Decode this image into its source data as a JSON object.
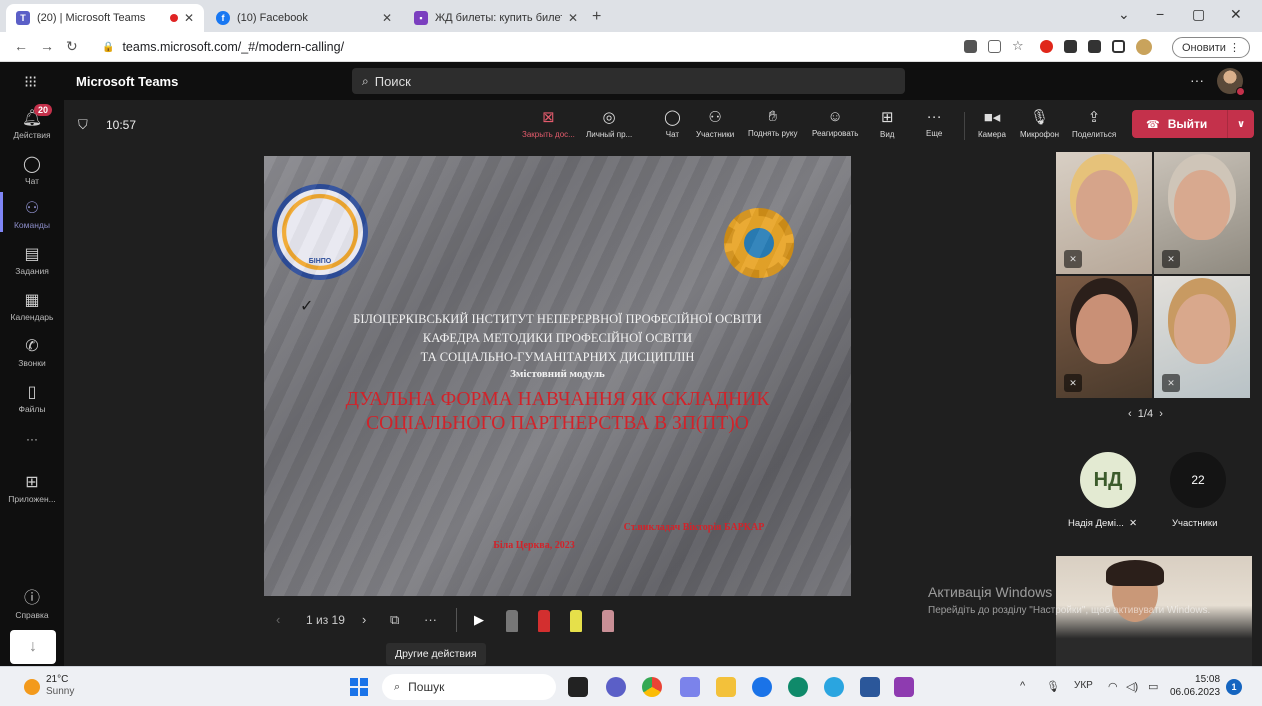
{
  "browser": {
    "tabs": [
      {
        "title": "(20) | Microsoft Teams",
        "active": true
      },
      {
        "title": "(10) Facebook",
        "active": false
      },
      {
        "title": "ЖД билеты: купить билет на по",
        "active": false
      }
    ],
    "url": "teams.microsoft.com/_#/modern-calling/",
    "update_label": "Оновити"
  },
  "teams": {
    "app_title": "Microsoft Teams",
    "search_placeholder": "Поиск",
    "rail": [
      {
        "label": "Действия",
        "icon": "bell-icon",
        "badge": "20"
      },
      {
        "label": "Чат",
        "icon": "chat-icon"
      },
      {
        "label": "Команды",
        "icon": "teams-icon",
        "active": true
      },
      {
        "label": "Задания",
        "icon": "assignments-icon"
      },
      {
        "label": "Календарь",
        "icon": "calendar-icon"
      },
      {
        "label": "Звонки",
        "icon": "phone-icon"
      },
      {
        "label": "Файлы",
        "icon": "file-icon"
      },
      {
        "label": "Приложен...",
        "icon": "apps-icon"
      },
      {
        "label": "Справка",
        "icon": "help-icon"
      }
    ]
  },
  "call": {
    "timer": "10:57",
    "controls": {
      "stop_sharing": "Закрыть дос...",
      "personal": "Личный пр...",
      "chat": "Чат",
      "participants": "Участники",
      "raise_hand": "Поднять руку",
      "react": "Реагировать",
      "view": "Вид",
      "more": "Еще",
      "camera": "Камера",
      "mic": "Микрофон",
      "share": "Поделиться"
    },
    "leave_label": "Выйти"
  },
  "slide": {
    "institute": "БІЛОЦЕРКІВСЬКИЙ ІНСТИТУТ НЕПЕРЕРВНОЇ ПРОФЕСІЙНОЇ ОСВІТИ",
    "department_1": "КАФЕДРА МЕТОДИКИ ПРОФЕСІЙНОЇ ОСВІТИ",
    "department_2": "ТА СОЦІАЛЬНО-ГУМАНІТАРНИХ ДИСЦИПЛІН",
    "module": "Змістовний модуль",
    "title_1": "ДУАЛЬНА ФОРМА НАВЧАННЯ ЯК СКЛАДНИК",
    "title_2": "СОЦІАЛЬНОГО ПАРТНЕРСТВА В ЗП(ПТ)О",
    "author": "Ст.викладач Вікторія БАРКАР",
    "city_year": "Біла Церква, 2023",
    "logo_left_text": "БІНПО",
    "page_indicator": "1 из 19",
    "tooltip": "Другие действия"
  },
  "participants": {
    "pager": "1/4",
    "avatar_initials": "НД",
    "avatar_name": "Надія Демі...",
    "count": "22",
    "count_label": "Участники"
  },
  "watermark": {
    "line1": "Активація Windows",
    "line2": "Перейдіть до розділу \"Настройки\", щоб активувати Windows."
  },
  "taskbar": {
    "temp": "21°C",
    "condition": "Sunny",
    "search": "Пошук",
    "lang": "УКР",
    "time": "15:08",
    "date": "06.06.2023",
    "notifications": "1"
  }
}
